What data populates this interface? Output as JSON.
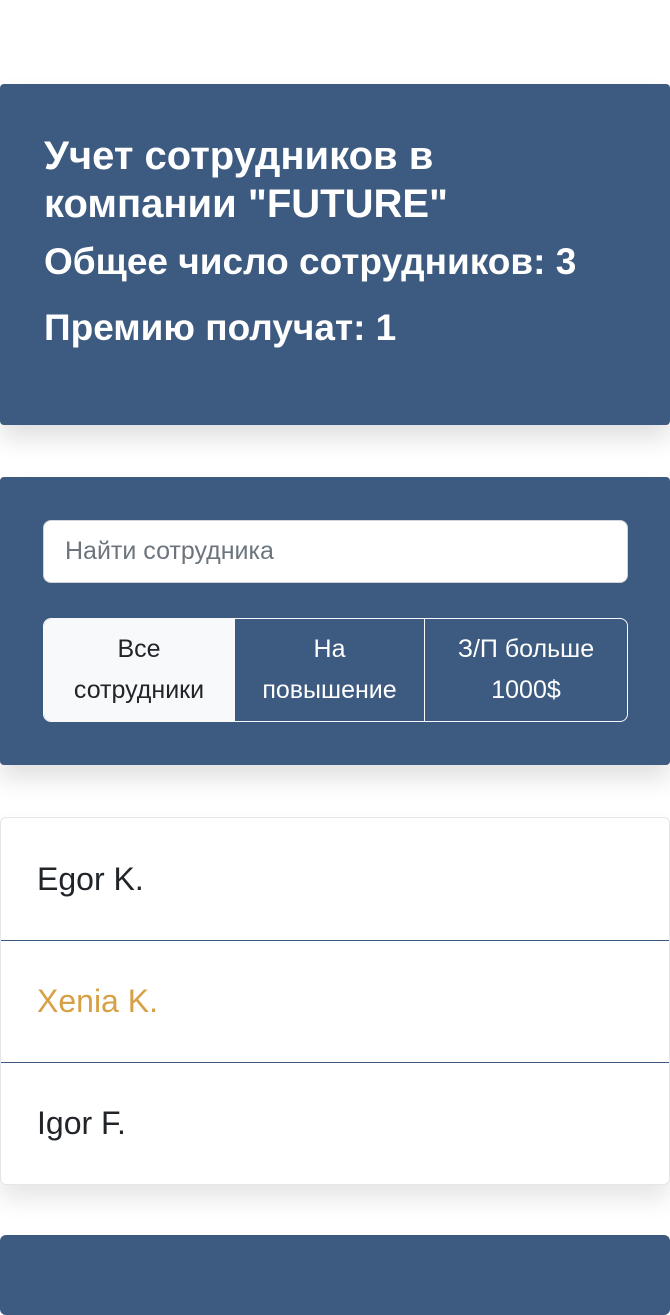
{
  "app_info": {
    "title": "Учет сотрудников в компании \"FUTURE\"",
    "total_label": "Общее число сотрудников: 3",
    "bonus_label": "Премию получат: 1"
  },
  "search": {
    "placeholder": "Найти сотрудника",
    "value": ""
  },
  "filters": [
    {
      "label": "Все сотрудники",
      "active": true
    },
    {
      "label": "На повышение",
      "active": false
    },
    {
      "label": "З/П больше 1000$",
      "active": false
    }
  ],
  "employees": [
    {
      "name": "Egor K.",
      "highlighted": false
    },
    {
      "name": "Xenia K.",
      "highlighted": true
    },
    {
      "name": "Igor F.",
      "highlighted": false
    }
  ],
  "colors": {
    "panel": "#3d5a80",
    "highlight": "#d6a045"
  }
}
